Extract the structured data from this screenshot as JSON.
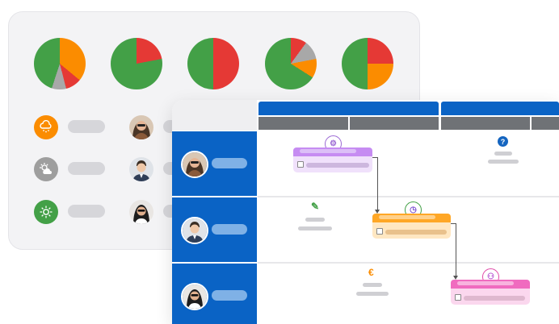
{
  "colors": {
    "green": "#43a047",
    "red": "#e53935",
    "orange": "#fb8c00",
    "gray": "#a8a8a8",
    "blue": "#0a63c5",
    "purple_task": "#c68cf2",
    "orange_task": "#ffa726",
    "pink_task": "#f06bbf"
  },
  "pies": [
    {
      "slices": [
        {
          "color": "orange",
          "value": 0.36
        },
        {
          "color": "red",
          "value": 0.1
        },
        {
          "color": "gray",
          "value": 0.09
        },
        {
          "color": "green",
          "value": 0.45
        }
      ]
    },
    {
      "slices": [
        {
          "color": "red",
          "value": 0.22
        },
        {
          "color": "green",
          "value": 0.78
        }
      ]
    },
    {
      "slices": [
        {
          "color": "red",
          "value": 0.5
        },
        {
          "color": "green",
          "value": 0.5
        }
      ]
    },
    {
      "slices": [
        {
          "color": "red",
          "value": 0.1
        },
        {
          "color": "gray",
          "value": 0.12
        },
        {
          "color": "orange",
          "value": 0.12
        },
        {
          "color": "green",
          "value": 0.66
        }
      ]
    },
    {
      "slices": [
        {
          "color": "red",
          "value": 0.25
        },
        {
          "color": "orange",
          "value": 0.25
        },
        {
          "color": "green",
          "value": 0.5
        }
      ]
    }
  ],
  "weather_icons": [
    {
      "name": "snow-cloud-icon",
      "bg": "#fb8c00"
    },
    {
      "name": "partly-cloudy-icon",
      "bg": "#9e9e9e"
    },
    {
      "name": "sun-icon",
      "bg": "#43a047"
    }
  ],
  "task_glyphs": {
    "task1": "⚙",
    "task2": "◷",
    "task3": "⚇",
    "help": "?",
    "edit": "✎",
    "euro": "€"
  }
}
